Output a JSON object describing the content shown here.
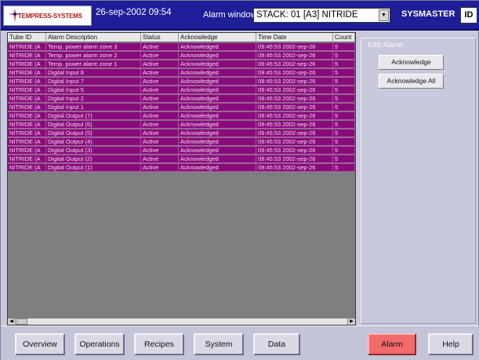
{
  "header": {
    "logo_text": "TEMPRESS-SYSTEMS",
    "datetime": "26-sep-2002 09:54",
    "window_title": "Alarm window",
    "stack_selected": "STACK: 01 [A3] NITRIDE",
    "user": "SYSMASTER",
    "id_label": "ID"
  },
  "alarm_list": {
    "columns": [
      "Tube ID",
      "Alarm Description",
      "Status",
      "Acknowledge",
      "Time Date",
      "Count"
    ],
    "rows": [
      [
        "NITRIDE (A",
        "Temp. power alarm zone 3",
        "Active",
        "Acknowledged",
        "09:45:53 2002-sep-26",
        "5"
      ],
      [
        "NITRIDE (A",
        "Temp. power alarm zone 2",
        "Active",
        "Acknowledged",
        "09:45:53 2002-sep-26",
        "5"
      ],
      [
        "NITRIDE (A",
        "Temp. power alarm zone 1",
        "Active",
        "Acknowledged",
        "09:45:53 2002-sep-26",
        "5"
      ],
      [
        "NITRIDE (A",
        "Digital Input 8",
        "Active",
        "Acknowledged",
        "09:45:53 2002-sep-26",
        "5"
      ],
      [
        "NITRIDE (A",
        "Digital Input 7",
        "Active",
        "Acknowledged",
        "09:45:53 2002-sep-26",
        "5"
      ],
      [
        "NITRIDE (A",
        "Digital Input 5",
        "Active",
        "Acknowledged",
        "09:45:53 2002-sep-26",
        "5"
      ],
      [
        "NITRIDE (A",
        "Digital Input 2",
        "Active",
        "Acknowledged",
        "09:45:53 2002-sep-26",
        "5"
      ],
      [
        "NITRIDE (A",
        "Digital Input 1",
        "Active",
        "Acknowledged",
        "09:45:53 2002-sep-26",
        "5"
      ],
      [
        "NITRIDE (A",
        "Digital Output (7)",
        "Active",
        "Acknowledged",
        "09:45:53 2002-sep-26",
        "5"
      ],
      [
        "NITRIDE (A",
        "Digital Output (6)",
        "Active",
        "Acknowledged",
        "09:45:53 2002-sep-26",
        "5"
      ],
      [
        "NITRIDE (A",
        "Digital Output (5)",
        "Active",
        "Acknowledged",
        "09:45:53 2002-sep-26",
        "5"
      ],
      [
        "NITRIDE (A",
        "Digital Output (4)",
        "Active",
        "Acknowledged",
        "09:45:53 2002-sep-26",
        "5"
      ],
      [
        "NITRIDE (A",
        "Digital Output (3)",
        "Active",
        "Acknowledged",
        "09:45:53 2002-sep-26",
        "5"
      ],
      [
        "NITRIDE (A",
        "Digital Output (2)",
        "Active",
        "Acknowledged",
        "09:45:53 2002-sep-26",
        "5"
      ],
      [
        "NITRIDE (A",
        "Digital Output (1)",
        "Active",
        "Acknowledged",
        "09:45:53 2002-sep-26",
        "5"
      ]
    ]
  },
  "edit_panel": {
    "title": "Edit Alarm",
    "acknowledge_label": "Acknowledge",
    "acknowledge_all_label": "Acknowledge All"
  },
  "nav": [
    {
      "label": "Overview"
    },
    {
      "label": "Operations"
    },
    {
      "label": "Recipes"
    },
    {
      "label": "System"
    },
    {
      "label": "Data"
    },
    {
      "label": "Alarm"
    },
    {
      "label": "Help"
    }
  ],
  "icons": {
    "logo": "tempress-logo-icon",
    "dropdown": "chevron-down-icon",
    "scroll_left": "arrow-left-icon",
    "scroll_right": "arrow-right-icon"
  },
  "colors": {
    "header_bg": "#1e1e99",
    "alarm_row": "#8a0a7d",
    "alarm_button": "#f26a6a",
    "panel_bg": "#c9c9dd",
    "list_empty_bg": "#7f7f7f"
  }
}
